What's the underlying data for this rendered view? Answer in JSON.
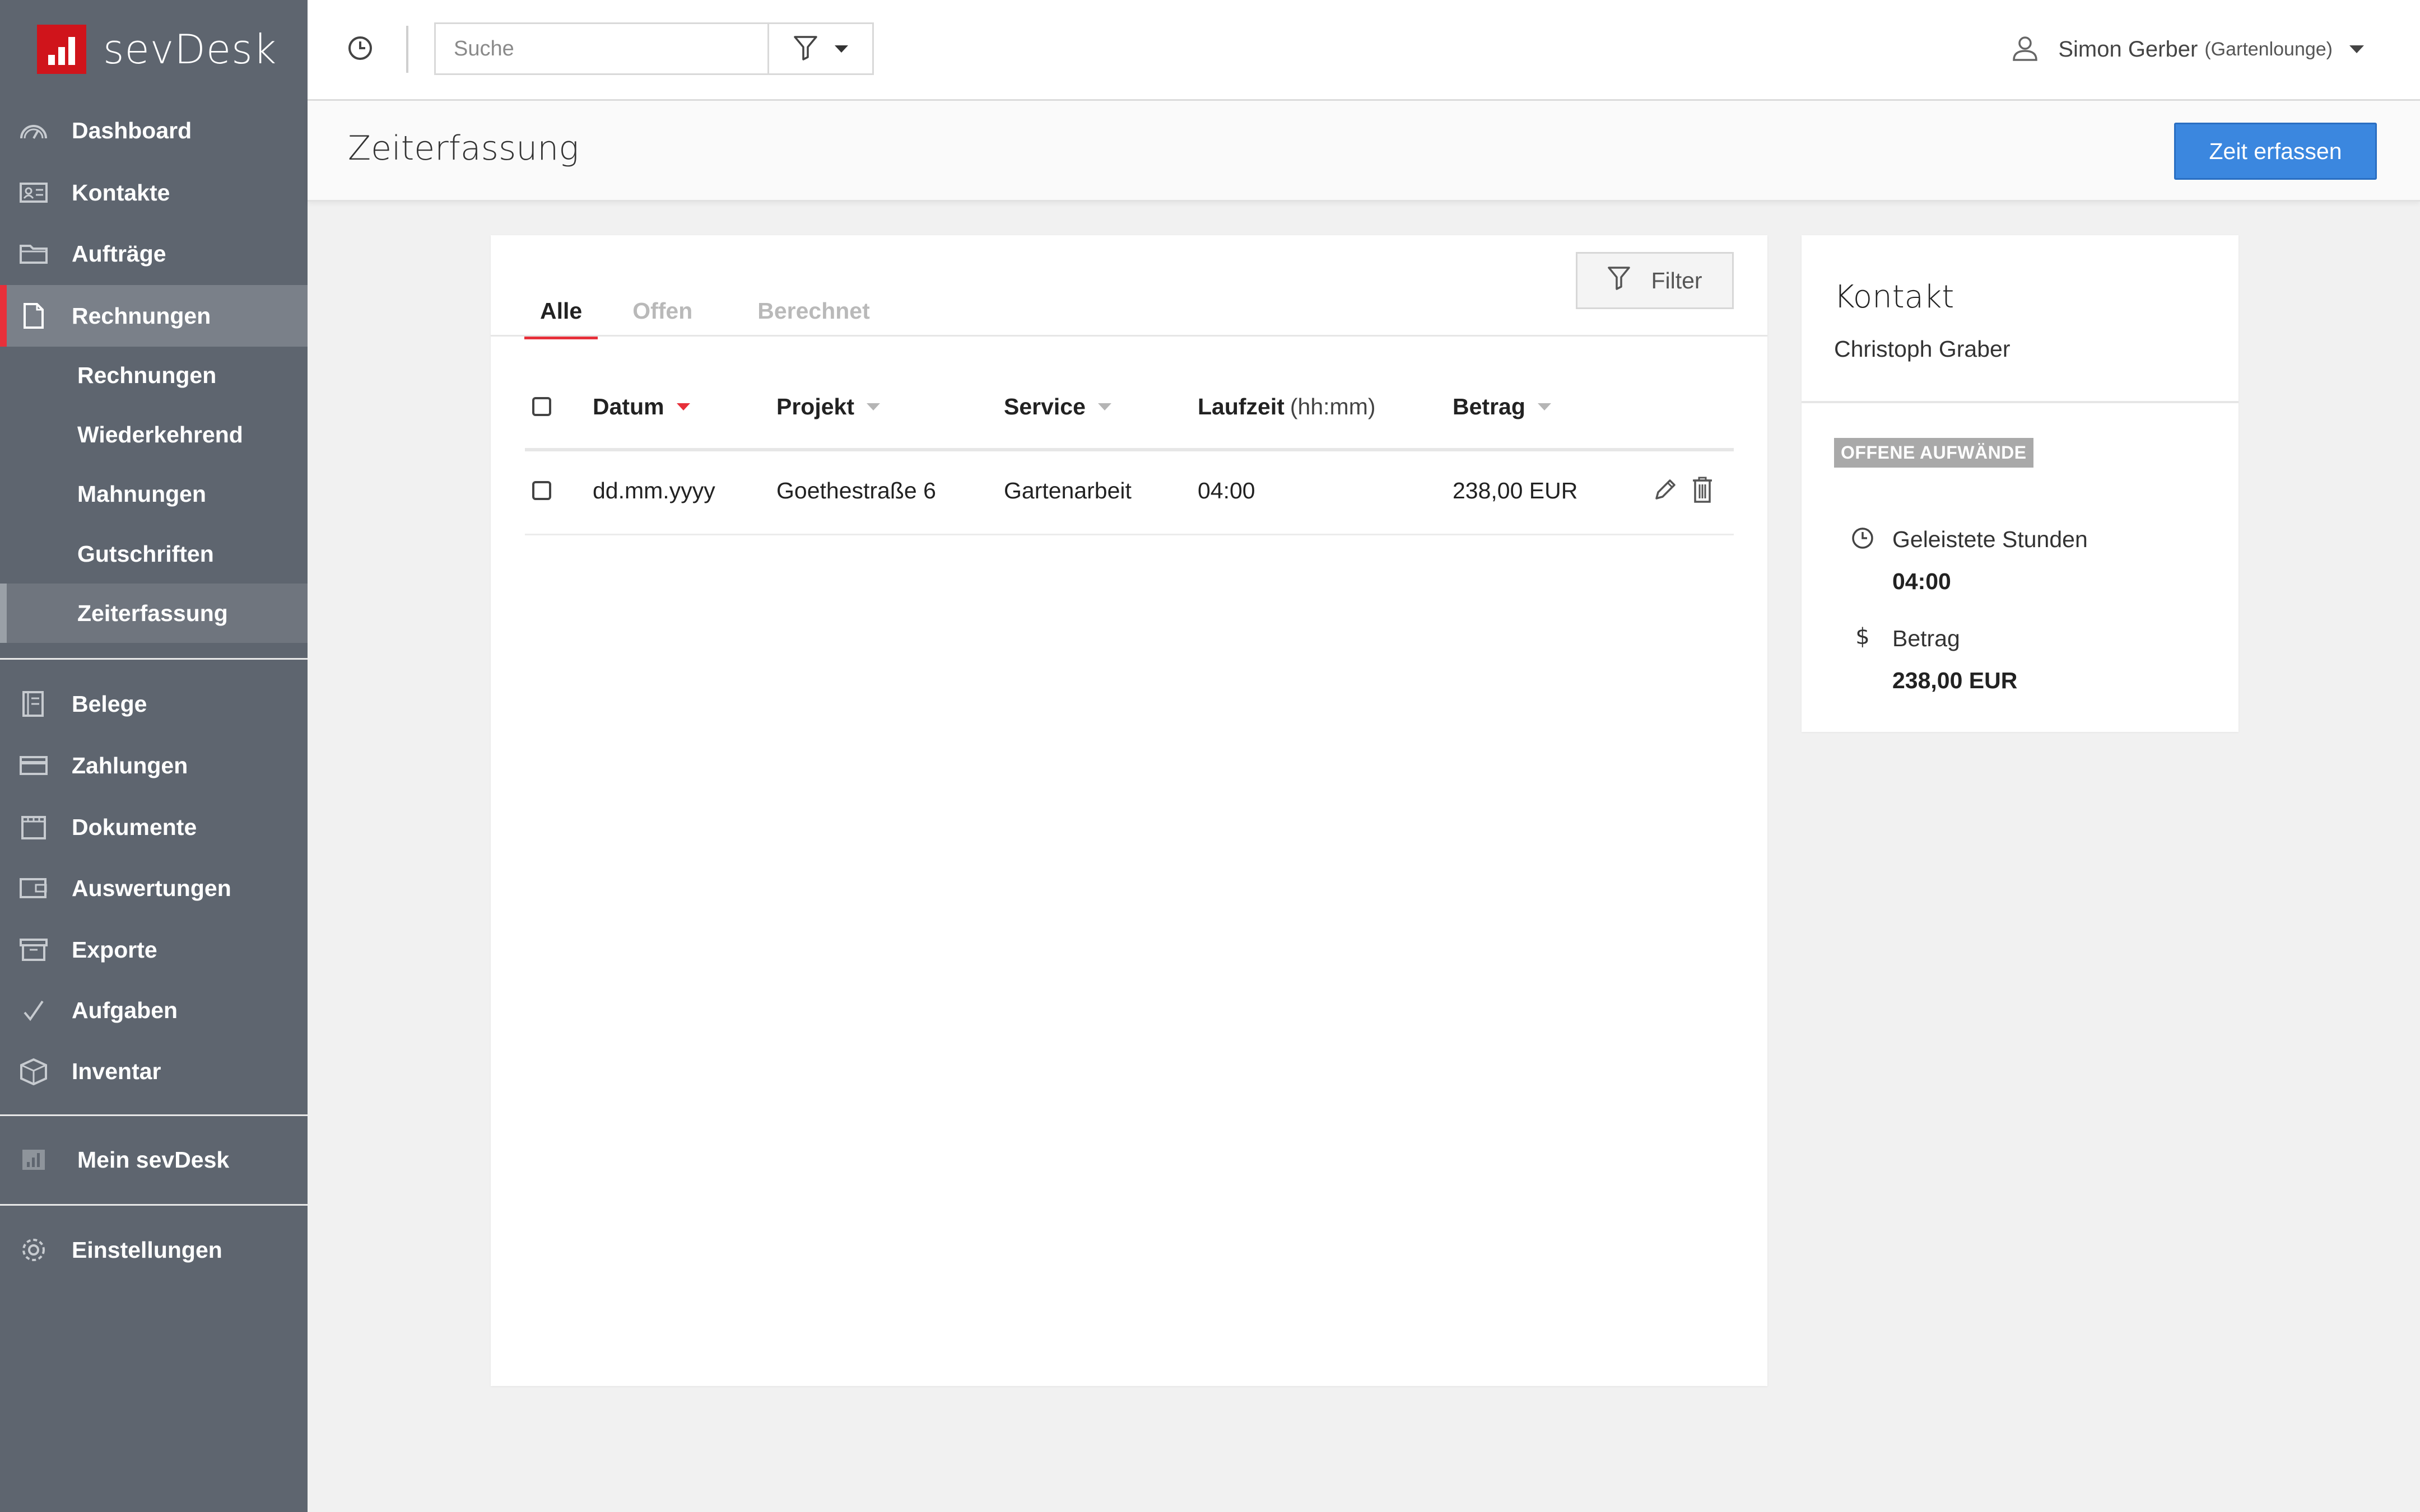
{
  "brand": {
    "name": "sevDesk",
    "logo_color": "#d0141b"
  },
  "sidebar": {
    "items": [
      {
        "label": "Dashboard",
        "icon": "dashboard-icon"
      },
      {
        "label": "Kontakte",
        "icon": "contact-card-icon"
      },
      {
        "label": "Aufträge",
        "icon": "folder-icon"
      },
      {
        "label": "Rechnungen",
        "icon": "document-icon",
        "active": true
      },
      {
        "label": "Belege",
        "icon": "receipt-icon"
      },
      {
        "label": "Zahlungen",
        "icon": "credit-card-icon"
      },
      {
        "label": "Dokumente",
        "icon": "documents-icon"
      },
      {
        "label": "Auswertungen",
        "icon": "wallet-icon"
      },
      {
        "label": "Exporte",
        "icon": "archive-box-icon"
      },
      {
        "label": "Aufgaben",
        "icon": "checkmark-icon"
      },
      {
        "label": "Inventar",
        "icon": "box-icon"
      },
      {
        "label": "Mein sevDesk",
        "icon": "bar-chart-icon"
      },
      {
        "label": "Einstellungen",
        "icon": "gear-icon"
      }
    ],
    "sub_items": [
      {
        "label": "Rechnungen"
      },
      {
        "label": "Wiederkehrend"
      },
      {
        "label": "Mahnungen"
      },
      {
        "label": "Gutschriften"
      },
      {
        "label": "Zeiterfassung",
        "active": true
      }
    ],
    "accent_color": "#e7303a",
    "background": "#5e656f"
  },
  "topbar": {
    "search_placeholder": "Suche",
    "user_name": "Simon Gerber",
    "user_org": "(Gartenlounge)"
  },
  "page": {
    "title": "Zeiterfassung",
    "primary_button": "Zeit erfassen",
    "primary_color": "#3b87df"
  },
  "main": {
    "tabs": [
      {
        "label": "Alle",
        "active": true
      },
      {
        "label": "Offen"
      },
      {
        "label": "Berechnet"
      }
    ],
    "filter_label": "Filter",
    "table": {
      "columns": [
        {
          "label": "Datum",
          "sort": "active"
        },
        {
          "label": "Projekt",
          "sort": "inactive"
        },
        {
          "label": "Service",
          "sort": "inactive"
        },
        {
          "label": "Laufzeit",
          "unit": "(hh:mm)"
        },
        {
          "label": "Betrag",
          "sort": "inactive"
        }
      ],
      "rows": [
        {
          "datum": "dd.mm.yyyy",
          "projekt": "Goethestraße 6",
          "service": "Gartenarbeit",
          "laufzeit": "04:00",
          "betrag": "238,00 EUR"
        }
      ]
    }
  },
  "contact": {
    "title": "Kontakt",
    "name": "Christoph Graber",
    "badge": "OFFENE AUFWÄNDE",
    "stats": [
      {
        "label": "Geleistete Stunden",
        "value": "04:00",
        "icon": "clock-icon"
      },
      {
        "label": "Betrag",
        "value": "238,00 EUR",
        "icon": "dollar-icon"
      }
    ]
  }
}
